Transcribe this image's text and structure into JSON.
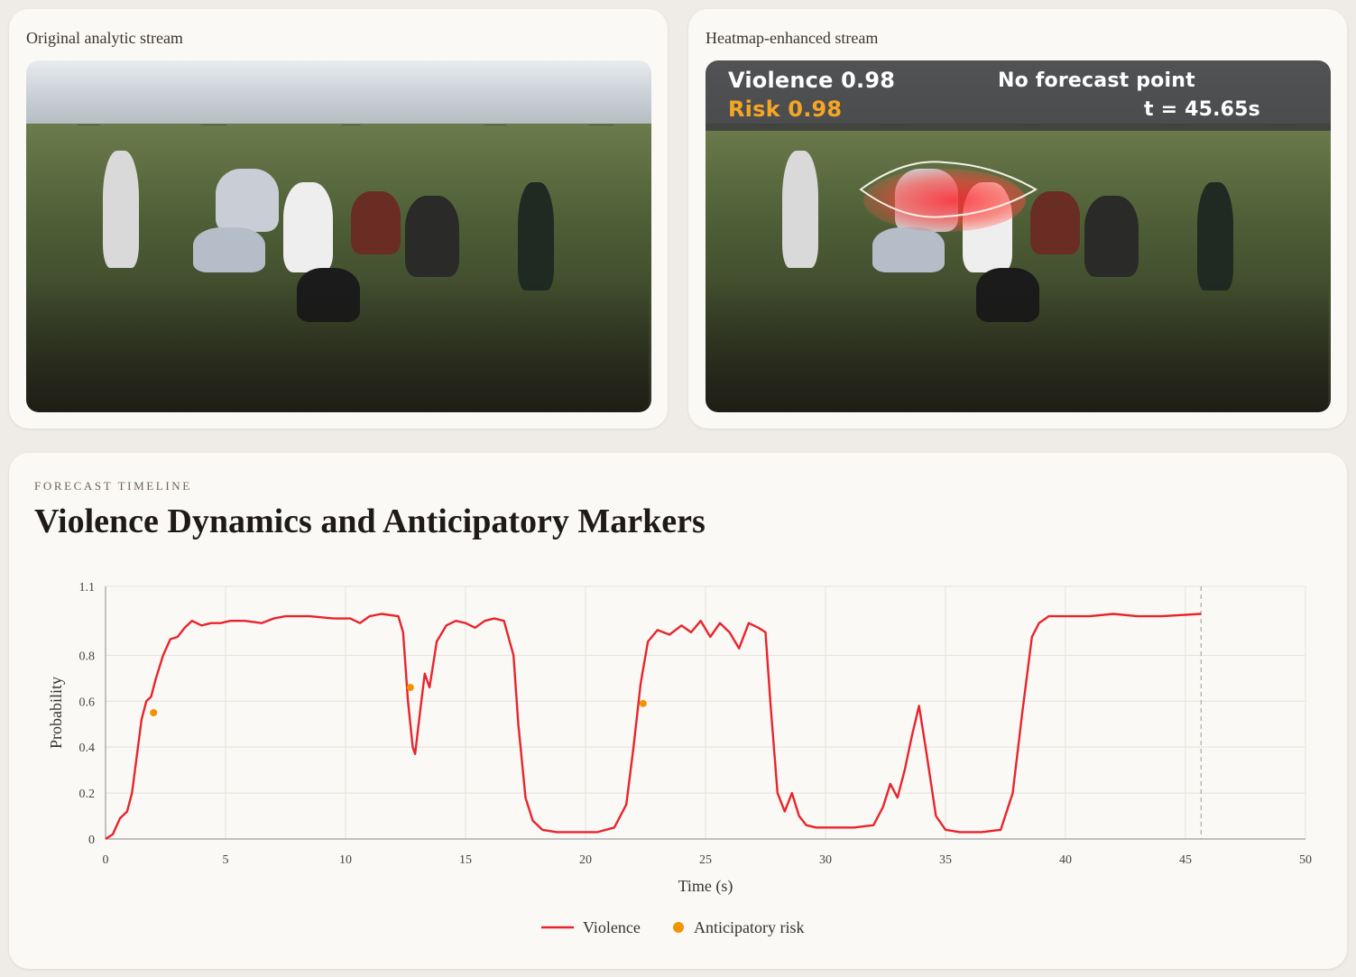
{
  "left_panel": {
    "title": "Original analytic stream"
  },
  "right_panel": {
    "title": "Heatmap-enhanced stream",
    "overlay": {
      "violence": "Violence 0.98",
      "risk": "Risk 0.98",
      "forecast": "No forecast point",
      "time": "t = 45.65s"
    }
  },
  "chart_panel": {
    "kicker": "FORECAST TIMELINE",
    "title": "Violence Dynamics and Anticipatory Markers"
  },
  "colors": {
    "violence": "#e8242c",
    "risk": "#f29400",
    "risk_text": "#f6a623",
    "overlay_text": "#ffffff"
  },
  "chart_data": {
    "type": "line",
    "xlabel": "Time (s)",
    "ylabel": "Probability",
    "xlim": [
      0,
      50
    ],
    "ylim": [
      0,
      1.1
    ],
    "xticks": [
      0,
      5,
      10,
      15,
      20,
      25,
      30,
      35,
      40,
      45,
      50
    ],
    "yticks": [
      0,
      0.2,
      0.4,
      0.6,
      0.8,
      1.1
    ],
    "grid": true,
    "legend_position": "bottom-center",
    "current_time": 45.65,
    "series": [
      {
        "name": "Violence",
        "kind": "line",
        "x": [
          0,
          0.3,
          0.6,
          0.9,
          1.1,
          1.3,
          1.5,
          1.7,
          1.9,
          2.1,
          2.4,
          2.7,
          3.0,
          3.3,
          3.6,
          4.0,
          4.4,
          4.8,
          5.2,
          5.8,
          6.5,
          7.0,
          7.5,
          8.5,
          9.5,
          10.2,
          10.6,
          11.0,
          11.5,
          12.2,
          12.4,
          12.6,
          12.8,
          12.9,
          13.1,
          13.3,
          13.5,
          13.8,
          14.2,
          14.6,
          15.0,
          15.4,
          15.8,
          16.2,
          16.6,
          17.0,
          17.2,
          17.5,
          17.8,
          18.2,
          18.8,
          19.5,
          20.5,
          21.2,
          21.7,
          22.0,
          22.3,
          22.6,
          23.0,
          23.5,
          24.0,
          24.4,
          24.8,
          25.2,
          25.6,
          26.0,
          26.4,
          26.8,
          27.2,
          27.5,
          27.7,
          28.0,
          28.3,
          28.6,
          28.9,
          29.2,
          29.6,
          30.4,
          31.2,
          32.0,
          32.4,
          32.7,
          33.0,
          33.3,
          33.6,
          33.9,
          34.2,
          34.6,
          35.0,
          35.6,
          36.5,
          37.3,
          37.8,
          38.2,
          38.6,
          38.9,
          39.3,
          40.0,
          41.0,
          42.0,
          43.0,
          44.0,
          45.65
        ],
        "y": [
          0.0,
          0.02,
          0.09,
          0.12,
          0.2,
          0.36,
          0.52,
          0.6,
          0.62,
          0.7,
          0.8,
          0.87,
          0.88,
          0.92,
          0.95,
          0.93,
          0.94,
          0.94,
          0.95,
          0.95,
          0.94,
          0.96,
          0.97,
          0.97,
          0.96,
          0.96,
          0.94,
          0.97,
          0.98,
          0.97,
          0.9,
          0.6,
          0.4,
          0.37,
          0.55,
          0.72,
          0.66,
          0.86,
          0.93,
          0.95,
          0.94,
          0.92,
          0.95,
          0.96,
          0.95,
          0.8,
          0.5,
          0.18,
          0.08,
          0.04,
          0.03,
          0.03,
          0.03,
          0.05,
          0.15,
          0.4,
          0.68,
          0.86,
          0.91,
          0.89,
          0.93,
          0.9,
          0.95,
          0.88,
          0.94,
          0.9,
          0.83,
          0.94,
          0.92,
          0.9,
          0.6,
          0.2,
          0.12,
          0.2,
          0.1,
          0.06,
          0.05,
          0.05,
          0.05,
          0.06,
          0.14,
          0.24,
          0.18,
          0.3,
          0.45,
          0.58,
          0.38,
          0.1,
          0.04,
          0.03,
          0.03,
          0.04,
          0.2,
          0.55,
          0.88,
          0.94,
          0.97,
          0.97,
          0.97,
          0.98,
          0.97,
          0.97,
          0.98
        ]
      },
      {
        "name": "Anticipatory risk",
        "kind": "markers",
        "x": [
          2.0,
          12.7,
          22.4
        ],
        "y": [
          0.55,
          0.66,
          0.59
        ]
      }
    ]
  }
}
